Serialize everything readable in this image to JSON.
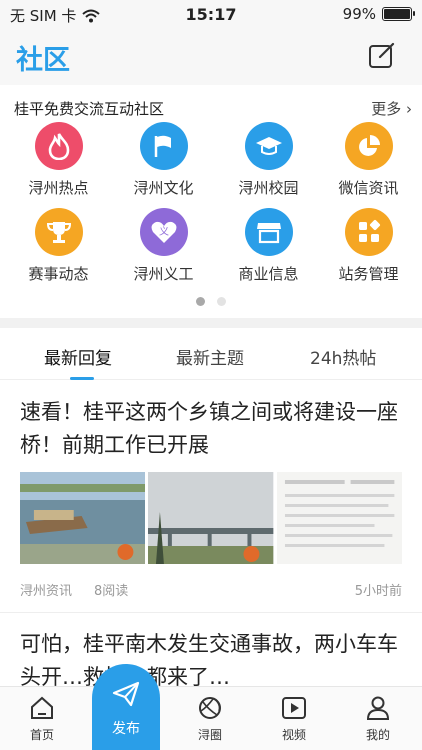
{
  "status_bar": {
    "carrier": "无 SIM 卡",
    "time": "15:17",
    "battery": "99%",
    "battery_level": 0.99
  },
  "header": {
    "title": "社区"
  },
  "community": {
    "heading": "桂平免费交流互动社区",
    "more": "更多",
    "items": [
      {
        "label": "浔州热点",
        "icon": "flame-icon",
        "color": "#ee4d6a"
      },
      {
        "label": "浔州文化",
        "icon": "flag-icon",
        "color": "#2a9ee8"
      },
      {
        "label": "浔州校园",
        "icon": "graduation-cap-icon",
        "color": "#2a9ee8"
      },
      {
        "label": "微信资讯",
        "icon": "pie-chart-icon",
        "color": "#f5a623"
      },
      {
        "label": "赛事动态",
        "icon": "trophy-icon",
        "color": "#f5a623"
      },
      {
        "label": "浔州义工",
        "icon": "heart-icon",
        "color": "#8e6ad8"
      },
      {
        "label": "商业信息",
        "icon": "store-icon",
        "color": "#2a9ee8"
      },
      {
        "label": "站务管理",
        "icon": "apps-icon",
        "color": "#f5a623"
      }
    ],
    "pager": {
      "pages": 2,
      "active": 1
    }
  },
  "tabs": [
    {
      "label": "最新回复",
      "active": true
    },
    {
      "label": "最新主题",
      "active": false
    },
    {
      "label": "24h热帖",
      "active": false
    }
  ],
  "posts": [
    {
      "title": "速看！桂平这两个乡镇之间或将建设一座桥！前期工作已开展",
      "source": "浔州资讯",
      "reads": "8阅读",
      "time": "5小时前"
    },
    {
      "title": "可怕，桂平南木发生交通事故，两小车车头开…救护车都来了…"
    }
  ],
  "bottom_nav": {
    "home": "首页",
    "publish": "发布",
    "circle": "浔圈",
    "video": "视频",
    "mine": "我的"
  },
  "accent_color": "#2a9ee8"
}
